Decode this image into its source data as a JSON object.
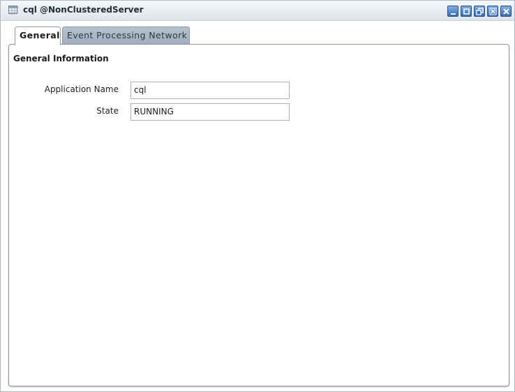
{
  "window": {
    "title": "cql @NonClusteredServer",
    "icon": "table-grid-icon",
    "controls": [
      "minimize-icon",
      "maximize-icon",
      "restore-icon",
      "close-inner-icon",
      "close-icon"
    ]
  },
  "tabs": [
    {
      "label": "General",
      "active": true
    },
    {
      "label": "Event Processing Network",
      "active": false
    }
  ],
  "general": {
    "section_title": "General Information",
    "fields": [
      {
        "label": "Application Name",
        "value": "cql"
      },
      {
        "label": "State",
        "value": "RUNNING"
      }
    ]
  },
  "colors": {
    "accent_blue": "#2f6fbe",
    "inactive_tab": "#a3afbe",
    "border": "#8c97a6"
  }
}
